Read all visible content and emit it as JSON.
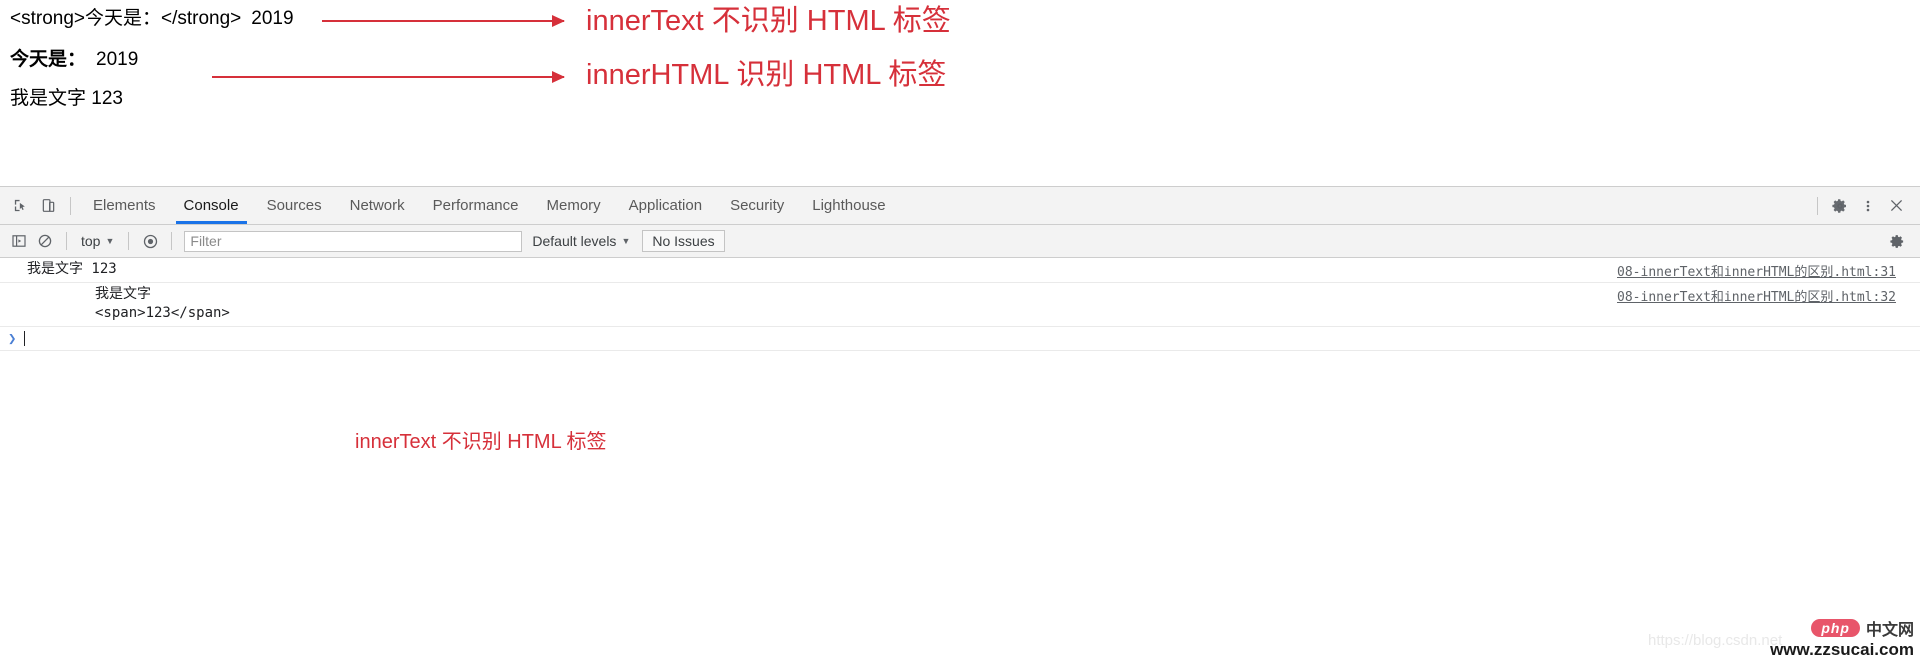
{
  "page_content": {
    "line1": {
      "code_open": "<strong>今天是：</strong>",
      "value": "2019"
    },
    "line2": {
      "label": "今天是：",
      "value": "2019"
    },
    "line3": "我是文字 123"
  },
  "annotations": {
    "arrow_color": "#d6303a",
    "top_1": "innerText 不识别 HTML 标签",
    "top_2": "innerHTML 识别 HTML 标签",
    "console": "innerText 不识别 HTML 标签"
  },
  "devtools": {
    "inspect_icon": "inspect-element-icon",
    "device_icon": "device-toolbar-icon",
    "tabs": [
      {
        "label": "Elements",
        "active": false
      },
      {
        "label": "Console",
        "active": true
      },
      {
        "label": "Sources",
        "active": false
      },
      {
        "label": "Network",
        "active": false
      },
      {
        "label": "Performance",
        "active": false
      },
      {
        "label": "Memory",
        "active": false
      },
      {
        "label": "Application",
        "active": false
      },
      {
        "label": "Security",
        "active": false
      },
      {
        "label": "Lighthouse",
        "active": false
      }
    ],
    "active_tab_underline_color": "#1a73e8",
    "right_icons": [
      "settings-gear-icon",
      "more-options-kebab-icon",
      "close-devtools-icon"
    ],
    "filter_bar": {
      "sidebar_icon": "console-sidebar-icon",
      "clear_icon": "clear-console-icon",
      "context": "top",
      "eye_icon": "live-expression-icon",
      "filter_value": "",
      "filter_placeholder": "Filter",
      "levels_label": "Default levels",
      "issues_label": "No Issues",
      "settings_icon": "console-settings-icon"
    },
    "console_messages": [
      {
        "text": "我是文字 123",
        "indented": false,
        "source": "08-innerText和innerHTML的区别.html:31"
      },
      {
        "text": "我是文字\n<span>123</span>",
        "indented": true,
        "source": "08-innerText和innerHTML的区别.html:32"
      }
    ],
    "prompt": {
      "arrow": "❯",
      "value": ""
    }
  },
  "watermarks": {
    "csdn": "https://blog.csdn.net",
    "php_badge": "php",
    "php_cn": "中文网",
    "php_url": "www.zzsucai.com"
  }
}
